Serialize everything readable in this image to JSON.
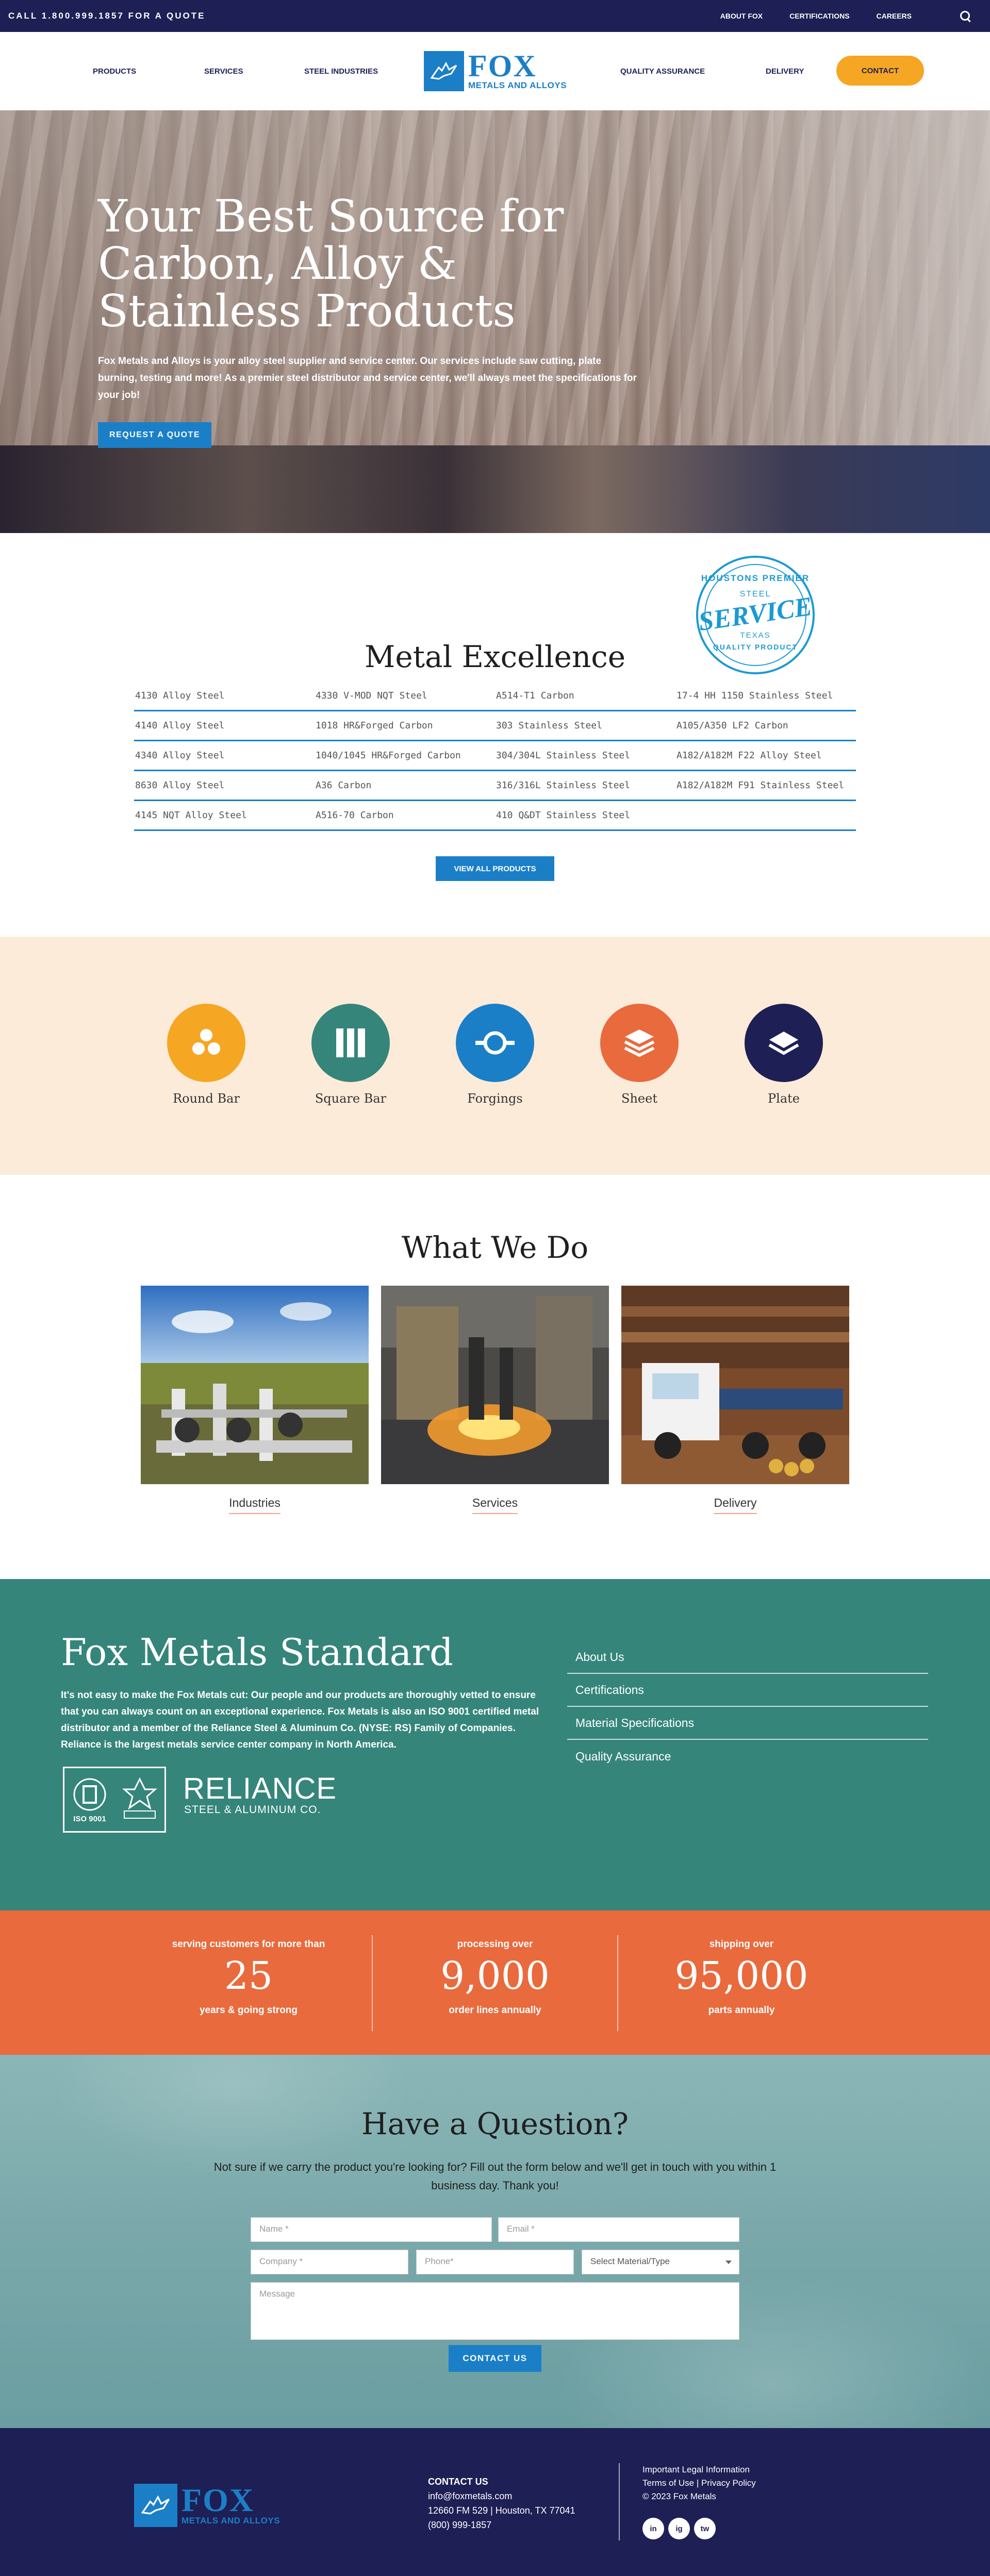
{
  "topbar": {
    "call": "CALL 1.800.999.1857 FOR A QUOTE",
    "links": [
      "ABOUT FOX",
      "CERTIFICATIONS",
      "CAREERS"
    ]
  },
  "nav": {
    "items": [
      "PRODUCTS",
      "SERVICES",
      "STEEL INDUSTRIES",
      "QUALITY ASSURANCE",
      "DELIVERY"
    ],
    "contact": "CONTACT"
  },
  "logo": {
    "name": "FOX",
    "tagline": "METALS AND ALLOYS"
  },
  "hero": {
    "title": "Your Best Source for Carbon, Alloy & Stainless Products",
    "text": "Fox Metals and Alloys is your alloy steel supplier and service center. Our services include saw cutting, plate burning, testing and more! As a premier steel distributor and service center, we'll always meet the specifications for your job!",
    "button": "REQUEST A QUOTE"
  },
  "stamp": {
    "top": "HOUSTONS PREMIER",
    "steel": "STEEL",
    "service": "SERVICE",
    "texas": "TEXAS",
    "quality": "QUALITY PRODUCT"
  },
  "excellence": {
    "title": "Metal Excellence",
    "rows": [
      [
        "4130 Alloy Steel",
        "4330 V-MOD NQT Steel",
        "A514-T1 Carbon",
        "17-4 HH 1150 Stainless Steel"
      ],
      [
        "4140 Alloy Steel",
        "1018 HR&Forged Carbon",
        "303 Stainless Steel",
        "A105/A350 LF2 Carbon"
      ],
      [
        "4340 Alloy Steel",
        "1040/1045 HR&Forged Carbon",
        "304/304L Stainless Steel",
        "A182/A182M F22 Alloy Steel"
      ],
      [
        "8630 Alloy Steel",
        "A36 Carbon",
        "316/316L Stainless Steel",
        "A182/A182M F91 Stainless Steel"
      ],
      [
        "4145 NQT Alloy Steel",
        "A516-70 Carbon",
        "410 Q&DT Stainless Steel",
        ""
      ]
    ],
    "button": "VIEW ALL PRODUCTS"
  },
  "shapes": [
    {
      "label": "Round Bar",
      "color": "#f5a623",
      "icon": "round-bar-icon"
    },
    {
      "label": "Square Bar",
      "color": "#35857a",
      "icon": "square-bar-icon"
    },
    {
      "label": "Forgings",
      "color": "#1b7fc8",
      "icon": "forgings-icon"
    },
    {
      "label": "Sheet",
      "color": "#e96a3d",
      "icon": "sheet-icon"
    },
    {
      "label": "Plate",
      "color": "#1e1f55",
      "icon": "plate-icon"
    }
  ],
  "whatwedo": {
    "title": "What We Do",
    "cards": [
      "Industries",
      "Services",
      "Delivery"
    ]
  },
  "standard": {
    "title": "Fox Metals Standard",
    "text": "It's not easy to make the Fox Metals cut: Our people and our products are thoroughly vetted to ensure that you can always count on an exceptional experience. Fox Metals is also an ISO 9001 certified metal distributor and a member of the Reliance Steel & Aluminum Co. (NYSE: RS) Family of Companies. Reliance is the largest metals service center company in North America.",
    "links": [
      "About Us",
      "Certifications",
      "Material Specifications",
      "Quality Assurance"
    ],
    "iso": "ISO 9001",
    "reliance": {
      "name": "RELIANCE",
      "sub": "STEEL & ALUMINUM CO."
    }
  },
  "stats": [
    {
      "above": "serving customers for more than",
      "value": "25",
      "below": "years & going strong"
    },
    {
      "above": "processing over",
      "value": "9,000",
      "below": "order lines annually"
    },
    {
      "above": "shipping over",
      "value": "95,000",
      "below": "parts annually"
    }
  ],
  "question": {
    "title": "Have a Question?",
    "text": "Not sure if we carry the product you're looking for? Fill out the form below and we'll get in touch with you within 1 business day. Thank you!",
    "placeholders": {
      "name": "Name *",
      "email": "Email *",
      "company": "Company *",
      "phone": "Phone*",
      "material": "Select Material/Type",
      "message": "Message"
    },
    "button": "CONTACT US"
  },
  "footer": {
    "contact_heading": "CONTACT US",
    "email": "info@foxmetals.com",
    "address": "12660 FM 529 | Houston, TX 77041",
    "phone": "(800) 999-1857",
    "legal": [
      "Important Legal Information",
      "Terms of Use | Privacy Policy",
      "© 2023 Fox Metals"
    ],
    "social": [
      "in",
      "ig",
      "tw"
    ]
  }
}
